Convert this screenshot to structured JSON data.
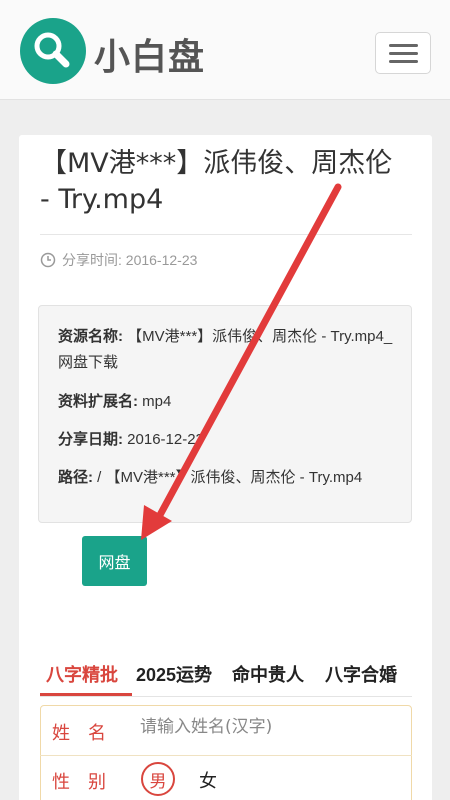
{
  "header": {
    "site_name": "小白盘",
    "logo_icon": "search-icon",
    "menu_icon": "hamburger-menu-icon",
    "brand_color": "#1aa38a"
  },
  "article": {
    "title": "【MV港***】派伟俊、周杰伦 - Try.mp4",
    "share_time": "分享时间: 2016-12-23",
    "clock_icon": "clock-icon"
  },
  "info": {
    "name_label": "资源名称:",
    "name_value": " 【MV港***】派伟俊、周杰伦 - Try.mp4_网盘下载",
    "ext_label": "资料扩展名:",
    "ext_value": " mp4",
    "date_label": "分享日期:",
    "date_value": " 2016-12-23",
    "path_label": "路径:",
    "path_value": " / 【MV港***】派伟俊、周杰伦 - Try.mp4"
  },
  "download_button": "网盘",
  "tabs": [
    {
      "label": "八字精批",
      "active": true
    },
    {
      "label": "2025运势",
      "active": false
    },
    {
      "label": "命中贵人",
      "active": false
    },
    {
      "label": "八字合婚",
      "active": false
    }
  ],
  "form": {
    "name_label": "姓　名",
    "name_placeholder": "请输入姓名(汉字)",
    "gender_label": "性　别",
    "gender_selected": "男",
    "gender_other": "女",
    "accent_color": "#d9463e"
  }
}
